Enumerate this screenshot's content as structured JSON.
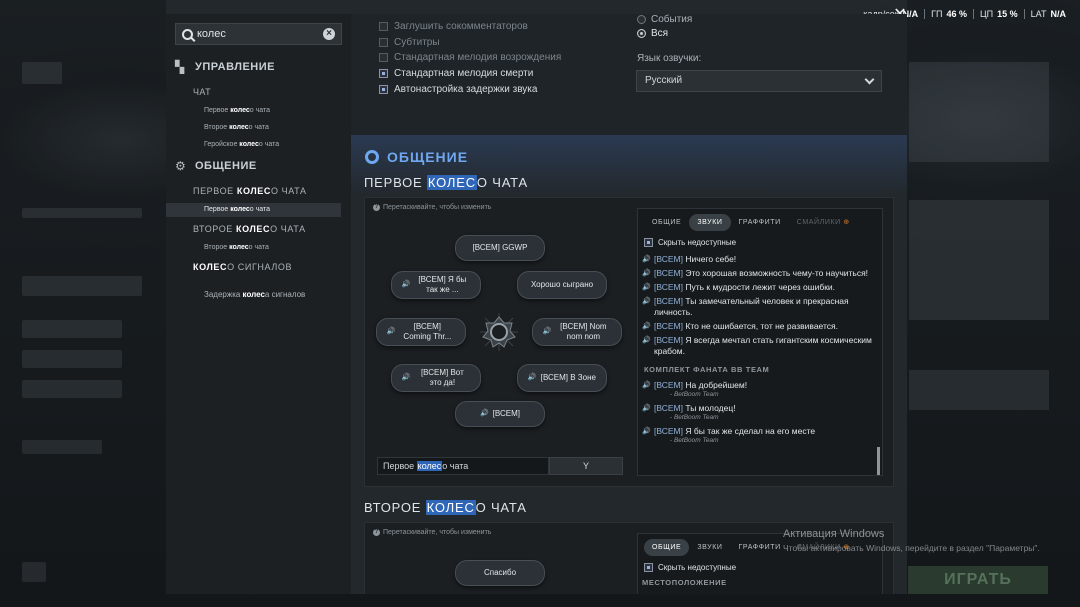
{
  "stats": {
    "fps_label": "кадр/сек",
    "fps_value": "N/A",
    "gpu_label": "ГП",
    "gpu_value": "46 %",
    "cpu_label": "ЦП",
    "cpu_value": "15 %",
    "lat_label": "LAT",
    "lat_value": "N/A"
  },
  "search": {
    "value": "колес"
  },
  "sidebar": {
    "control": "УПРАВЛЕНИЕ",
    "chat": "ЧАТ",
    "chat_items": [
      "Первое колесо чата",
      "Второе колесо чата",
      "Геройское колесо чата"
    ],
    "social": "ОБЩЕНИЕ",
    "first_wheel": "ПЕРВОЕ КОЛЕСО ЧАТА",
    "first_wheel_leaf": "Первое колесо чата",
    "second_wheel": "ВТОРОЕ КОЛЕСО ЧАТА",
    "second_wheel_leaf": "Второе колесо чата",
    "signal_wheel": "КОЛЕСО СИГНАЛОВ",
    "signal_delay": "Задержка колеса сигналов"
  },
  "options": {
    "mute_casters": "Заглушить сокомментаторов",
    "subtitles": "Субтитры",
    "respawn_melody": "Стандартная мелодия возрождения",
    "death_melody": "Стандартная мелодия смерти",
    "auto_delay": "Автонастройка задержки звука"
  },
  "radio": {
    "events": "События",
    "all": "Вся"
  },
  "voice": {
    "label": "Язык озвучки:",
    "value": "Русский"
  },
  "section": {
    "title": "ОБЩЕНИЕ",
    "first_title_a": "ПЕРВОЕ ",
    "first_title_hl": "КОЛЕС",
    "first_title_b": "О ЧАТА",
    "second_title_a": "ВТОРОЕ ",
    "second_title_hl": "КОЛЕС",
    "second_title_b": "О ЧАТА",
    "hint": "Перетаскивайте, чтобы изменить"
  },
  "wheel": {
    "top": "[ВСЕМ] GGWP",
    "ul": "[ВСЕМ] Я бы так же ...",
    "ur": "Хорошо сыграно",
    "l": "[ВСЕМ] Coming Thr...",
    "r": "[ВСЕМ] Nom nom nom",
    "bl": "[ВСЕМ] Вот это да!",
    "br": "[ВСЕМ] В Зоне",
    "bottom": "[ВСЕМ]",
    "bind_name_a": "Первое ",
    "bind_name_hl": "колес",
    "bind_name_b": "о чата",
    "bind_key": "Y"
  },
  "wheel2": {
    "top": "Спасибо"
  },
  "tabs": [
    "ОБЩИЕ",
    "ЗВУКИ",
    "ГРАФФИТИ",
    "СМАЙЛИКИ"
  ],
  "hide_unavailable": "Скрыть недоступные",
  "phrases": [
    {
      "tag": "[ВСЕМ]",
      "text": "Ничего себе!"
    },
    {
      "tag": "[ВСЕМ]",
      "text": "Это хорошая возможность чему-то научиться!"
    },
    {
      "tag": "[ВСЕМ]",
      "text": "Путь к мудрости лежит через ошибки."
    },
    {
      "tag": "[ВСЕМ]",
      "text": "Ты замечательный человек и прекрасная личность."
    },
    {
      "tag": "[ВСЕМ]",
      "text": "Кто не ошибается, тот не развивается."
    },
    {
      "tag": "[ВСЕМ]",
      "text": "Я всегда мечтал стать гигантским космическим крабом."
    }
  ],
  "group": "КОМПЛЕКТ ФАНАТА BB TEAM",
  "group_phrases": [
    {
      "tag": "[ВСЕМ]",
      "text": "На добрейшем!",
      "author": "- BetBoom Team"
    },
    {
      "tag": "[ВСЕМ]",
      "text": "Ты молодец!",
      "author": "- BetBoom Team"
    },
    {
      "tag": "[ВСЕМ]",
      "text": "Я бы так же сделал на его месте",
      "author": "- BetBoom Team"
    }
  ],
  "panel2": {
    "group": "МЕСТОПОЛОЖЕНИЕ"
  },
  "watermark": {
    "title": "Активация Windows",
    "sub": "Чтобы активировать Windows, перейдите в раздел \"Параметры\"."
  },
  "play": "ИГРАТЬ"
}
